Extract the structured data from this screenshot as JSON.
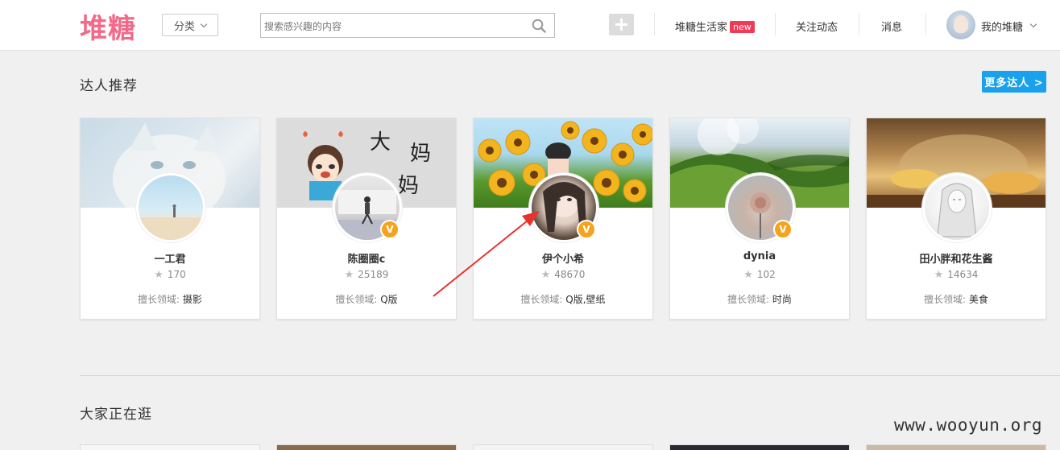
{
  "header": {
    "logo": "堆糖",
    "category_label": "分类",
    "search_placeholder": "搜索感兴趣的内容",
    "nav": {
      "life": "堆糖生活家",
      "new_badge": "new",
      "follow": "关注动态",
      "messages": "消息",
      "my": "我的堆糖"
    }
  },
  "recommend": {
    "title": "达人推荐",
    "more_label": "更多达人 >",
    "field_label": "擅长领域:",
    "cards": [
      {
        "name": "一工君",
        "count": "170",
        "field": "摄影",
        "verified": false
      },
      {
        "name": "陈圈圈c",
        "count": "25189",
        "field": "Q版",
        "verified": true
      },
      {
        "name": "伊个小希",
        "count": "48670",
        "field": "Q版,壁纸",
        "verified": true
      },
      {
        "name": "dynia",
        "count": "102",
        "field": "时尚",
        "verified": true
      },
      {
        "name": "田小胖和花生酱",
        "count": "14634",
        "field": "美食",
        "verified": false
      }
    ]
  },
  "browsing": {
    "title": "大家正在逛"
  },
  "badge_letter": "V",
  "watermark": "www.wooyun.org",
  "colors": {
    "brand": "#f26a8a",
    "accent_blue": "#1aa1ee",
    "new_badge": "#ef3b57",
    "verified": "#f5a31d",
    "arrow": "#e8322e"
  }
}
